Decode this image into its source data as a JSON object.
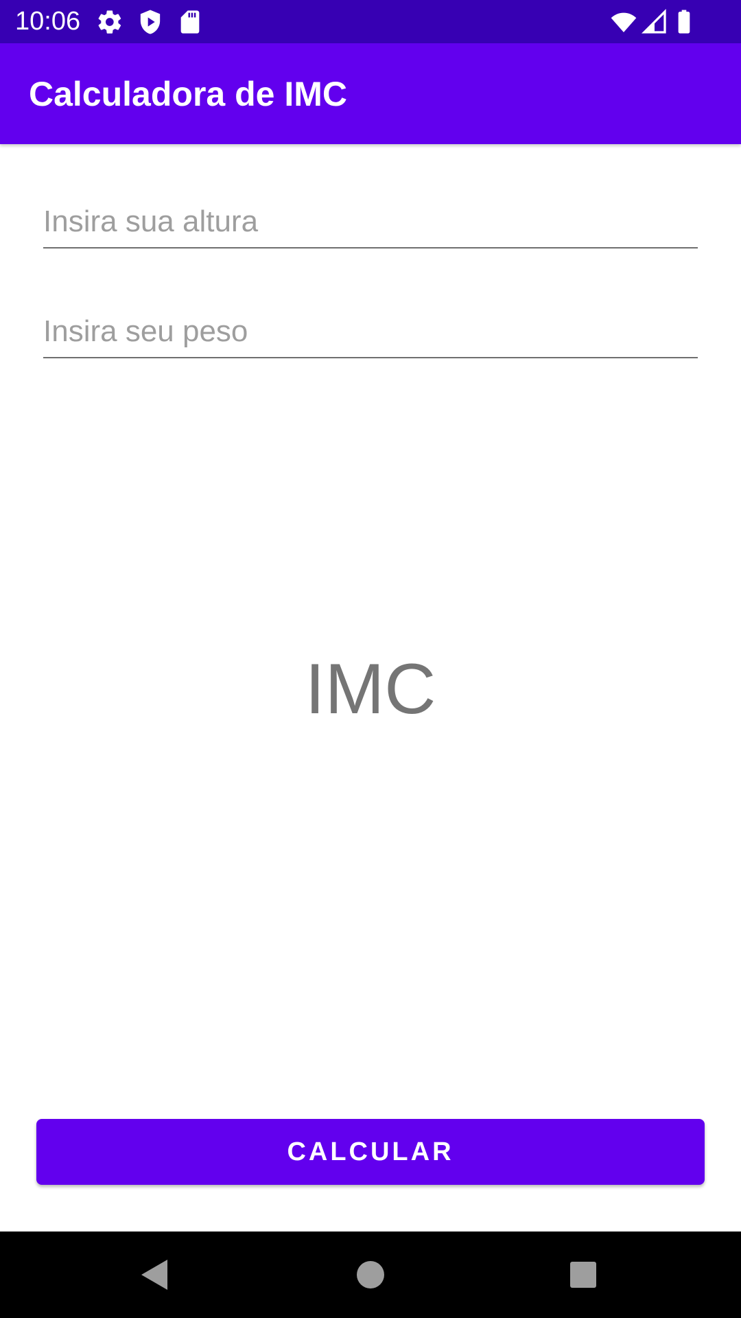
{
  "status_bar": {
    "time": "10:06",
    "left_icons": [
      "gear-icon",
      "shield-play-icon",
      "sd-card-icon"
    ],
    "right_icons": [
      "wifi-icon",
      "signal-icon",
      "battery-icon"
    ],
    "background_color": "#3700b3"
  },
  "app_bar": {
    "title": "Calculadora de IMC",
    "background_color": "#6200ee"
  },
  "form": {
    "height_field": {
      "value": "",
      "placeholder": "Insira sua altura"
    },
    "weight_field": {
      "value": "",
      "placeholder": "Insira seu peso"
    }
  },
  "result": {
    "label": "IMC",
    "color": "#757575"
  },
  "actions": {
    "calculate_label": "CALCULAR",
    "accent_color": "#6200ee"
  },
  "navigation_bar": {
    "buttons": [
      "back-icon",
      "home-icon",
      "recents-icon"
    ]
  }
}
